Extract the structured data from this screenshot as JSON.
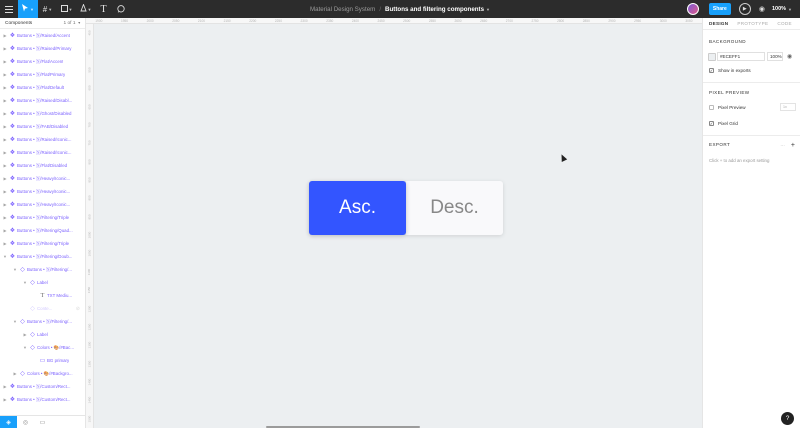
{
  "toolbar": {
    "project": "Material Design System",
    "separator": "/",
    "file_name": "Buttons and filtering components",
    "share_label": "Share",
    "zoom": "100%"
  },
  "left_panel": {
    "pages_label": "Components",
    "pages_count": "1 of 1",
    "layers": [
      {
        "label": "Buttons • 🅂/Raised/Accent",
        "indent": 0,
        "type": "component"
      },
      {
        "label": "Buttons • 🅂/Raised/Primary",
        "indent": 0,
        "type": "component"
      },
      {
        "label": "Buttons • 🅂/Flat/Accent",
        "indent": 0,
        "type": "component"
      },
      {
        "label": "Buttons • 🅂/Flat/Primary",
        "indent": 0,
        "type": "component"
      },
      {
        "label": "Buttons • 🅂/Flat/Default",
        "indent": 0,
        "type": "component"
      },
      {
        "label": "Buttons • 🅂/Raised/Disabl...",
        "indent": 0,
        "type": "component"
      },
      {
        "label": "Buttons • 🅂/Ghost/Disabled",
        "indent": 0,
        "type": "component"
      },
      {
        "label": "Buttons • 🅂/FAB/Disabled",
        "indent": 0,
        "type": "component"
      },
      {
        "label": "Buttons • 🅂/Raised/Iconic...",
        "indent": 0,
        "type": "component"
      },
      {
        "label": "Buttons • 🅂/Raised/Iconic...",
        "indent": 0,
        "type": "component"
      },
      {
        "label": "Buttons • 🅂/Flat/Disabled",
        "indent": 0,
        "type": "component"
      },
      {
        "label": "Buttons • 🅂/Heavy/Iconic...",
        "indent": 0,
        "type": "component"
      },
      {
        "label": "Buttons • 🅂/Heavy/Iconic...",
        "indent": 0,
        "type": "component"
      },
      {
        "label": "Buttons • 🅂/Heavy/Iconic...",
        "indent": 0,
        "type": "component"
      },
      {
        "label": "Buttons • 🅂/Filtering/Triple",
        "indent": 0,
        "type": "component"
      },
      {
        "label": "Buttons • 🅂/Filtering/Quad...",
        "indent": 0,
        "type": "component"
      },
      {
        "label": "Buttons • 🅂/Filtering/Triple",
        "indent": 0,
        "type": "component"
      },
      {
        "label": "Buttons • 🅂/Filtering/Doub...",
        "indent": 0,
        "type": "component",
        "expanded": true
      },
      {
        "label": "Buttons • 🅂/Filtering/...",
        "indent": 1,
        "type": "instance",
        "expanded": true
      },
      {
        "label": "Label",
        "indent": 2,
        "type": "instance",
        "expanded": true
      },
      {
        "label": "TXT Mediu...",
        "indent": 3,
        "type": "text"
      },
      {
        "label": "Conte...",
        "indent": 2,
        "type": "hidden"
      },
      {
        "label": "Buttons • 🅂/Filtering/...",
        "indent": 1,
        "type": "instance",
        "expanded": true
      },
      {
        "label": "Label",
        "indent": 2,
        "type": "instance"
      },
      {
        "label": "Colors • 🎨/#Bac...",
        "indent": 2,
        "type": "instance",
        "expanded": true
      },
      {
        "label": "BG primary",
        "indent": 3,
        "type": "rect"
      },
      {
        "label": "Colors • 🎨/#Backgro...",
        "indent": 1,
        "type": "instance"
      },
      {
        "label": "Buttons • 🅂/Custom/Rect...",
        "indent": 0,
        "type": "component"
      },
      {
        "label": "Buttons • 🅂/Custom/Rect...",
        "indent": 0,
        "type": "component"
      }
    ]
  },
  "ruler": {
    "top": [
      "1900",
      "1950",
      "2000",
      "2050",
      "2100",
      "2150",
      "2200",
      "2250",
      "2300",
      "2350",
      "2400",
      "2450",
      "2500",
      "2550",
      "2600",
      "2650",
      "2700",
      "2750",
      "2800",
      "2850",
      "2900",
      "2950",
      "3000",
      "3050"
    ],
    "left": [
      "450",
      "500",
      "550",
      "600",
      "650",
      "700",
      "750",
      "800",
      "850",
      "900",
      "950",
      "1000",
      "1050",
      "1100",
      "1150",
      "1200",
      "1250",
      "1300",
      "1350",
      "1400",
      "1450",
      "1500"
    ]
  },
  "canvas": {
    "background": "#ECEFF1",
    "asc_label": "Asc.",
    "desc_label": "Desc.",
    "asc_color": "#3355FF",
    "desc_color": "#F9F9FB"
  },
  "right_panel": {
    "tabs": [
      "DESIGN",
      "PROTOTYPE",
      "CODE"
    ],
    "background_title": "BACKGROUND",
    "bg_hex": "#ECEFF1",
    "bg_opacity": "100%",
    "show_in_exports": "Show in exports",
    "pixel_preview_title": "PIXEL PREVIEW",
    "pixel_preview_label": "Pixel Preview",
    "pixel_preview_select": "1x",
    "pixel_grid_label": "Pixel Grid",
    "export_title": "EXPORT",
    "export_hint": "Click + to add an export setting"
  },
  "icons": {
    "menu": "hamburger-icon",
    "move": "cursor-arrow-icon",
    "frame": "frame-hash-icon",
    "shape": "rectangle-icon",
    "pen": "pen-icon",
    "text": "text-T-icon",
    "comment": "speech-bubble-icon",
    "play": "play-icon",
    "view": "eye-icon",
    "help": "question-icon"
  },
  "accent": "#18A0FB"
}
